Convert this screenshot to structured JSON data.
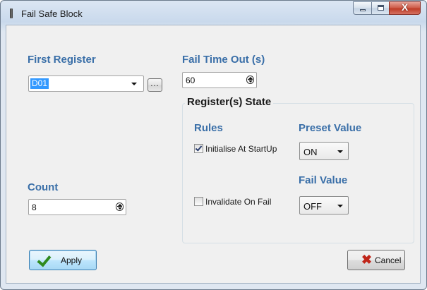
{
  "window": {
    "title": "Fail Safe Block"
  },
  "window_controls": {
    "close_glyph": "X"
  },
  "first_register": {
    "label": "First Register",
    "value": "D01",
    "browse_label": "..."
  },
  "fail_timeout": {
    "label": "Fail Time Out (s)",
    "value": "60"
  },
  "count": {
    "label": "Count",
    "value": "8"
  },
  "register_state": {
    "title": "Register(s) State",
    "rules_label": "Rules",
    "preset_label": "Preset Value",
    "fail_value_label": "Fail Value",
    "initialise_label": "Initialise At StartUp",
    "initialise_checked": true,
    "invalidate_label": "Invalidate On Fail",
    "invalidate_checked": false,
    "preset_value": "ON",
    "fail_value": "OFF"
  },
  "buttons": {
    "apply": "Apply",
    "cancel": "Cancel"
  },
  "colors": {
    "heading_blue": "#3a6fa8",
    "selection_blue": "#3399ff",
    "apply_check_green": "#2f8a1e",
    "cancel_x_red": "#c0261a"
  },
  "icons": [
    "app-icon",
    "minimize-icon",
    "maximize-icon",
    "close-icon",
    "spinner-icon",
    "chevron-down-icon",
    "checkmark-icon",
    "x-icon"
  ]
}
